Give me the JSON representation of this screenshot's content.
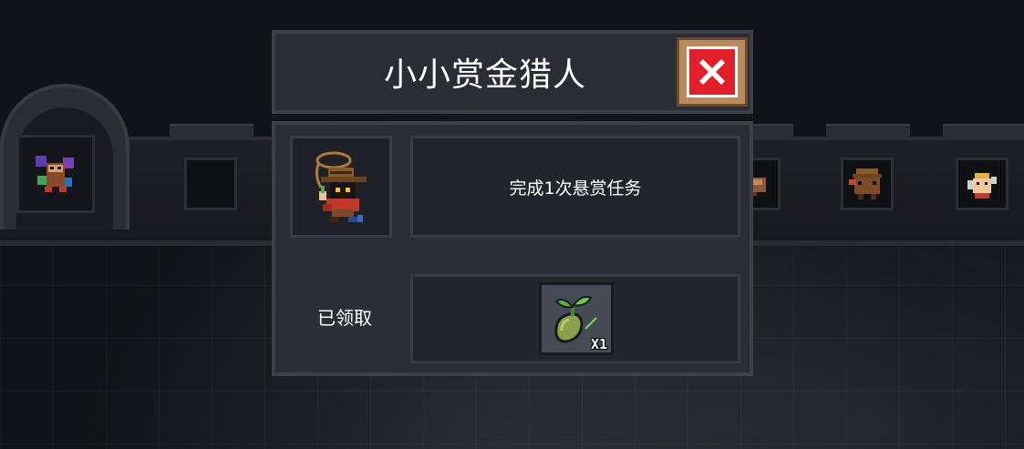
{
  "dialog": {
    "title": "小小赏金猎人",
    "description": "完成1次悬赏任务",
    "status": "已领取",
    "reward": {
      "icon": "seed-sprout-icon",
      "quantity": "X1"
    }
  },
  "colors": {
    "close_button_red": "#e11f2b",
    "close_button_frame": "#b98a5c",
    "panel_bg": "#2b2e36"
  },
  "background": {
    "icons": [
      "character-icon",
      "empty-slot",
      "character-icon",
      "character-icon",
      "character-icon"
    ]
  }
}
